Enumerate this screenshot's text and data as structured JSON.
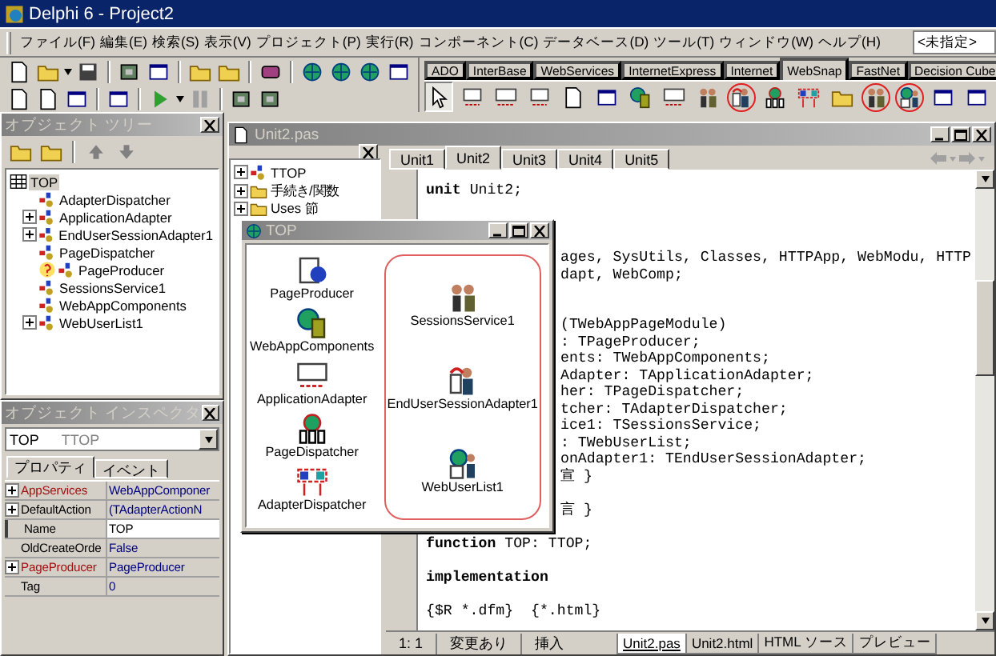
{
  "window": {
    "title": "Delphi 6 - Project2"
  },
  "menu": [
    {
      "label": "ファイル(F)"
    },
    {
      "label": "編集(E)"
    },
    {
      "label": "検索(S)"
    },
    {
      "label": "表示(V)"
    },
    {
      "label": "プロジェクト(P)"
    },
    {
      "label": "実行(R)"
    },
    {
      "label": "コンポーネント(C)"
    },
    {
      "label": "データベース(D)"
    },
    {
      "label": "ツール(T)"
    },
    {
      "label": "ウィンドウ(W)"
    },
    {
      "label": "ヘルプ(H)"
    }
  ],
  "component_combo": {
    "value": "<未指定>"
  },
  "palette": {
    "tabs": [
      {
        "label": "ADO",
        "selected": false
      },
      {
        "label": "InterBase",
        "selected": false
      },
      {
        "label": "WebServices",
        "selected": false
      },
      {
        "label": "InternetExpress",
        "selected": false
      },
      {
        "label": "Internet",
        "selected": false
      },
      {
        "label": "WebSnap",
        "selected": true
      },
      {
        "label": "FastNet",
        "selected": false
      },
      {
        "label": "Decision Cube",
        "selected": false
      }
    ],
    "components": [
      {
        "highlighted": false
      },
      {
        "highlighted": false
      },
      {
        "highlighted": false
      },
      {
        "highlighted": false
      },
      {
        "highlighted": false
      },
      {
        "highlighted": false
      },
      {
        "highlighted": false
      },
      {
        "highlighted": false
      },
      {
        "highlighted": true
      },
      {
        "highlighted": false
      },
      {
        "highlighted": false
      },
      {
        "highlighted": false
      },
      {
        "highlighted": true
      },
      {
        "highlighted": true
      },
      {
        "highlighted": false
      },
      {
        "highlighted": false
      }
    ]
  },
  "object_tree": {
    "title": "オブジェクト ツリー",
    "root": {
      "label": "TOP",
      "selected": true,
      "children": [
        {
          "label": "AdapterDispatcher",
          "expandable": false,
          "warning": false,
          "selected": false
        },
        {
          "label": "ApplicationAdapter",
          "expandable": true,
          "warning": false,
          "selected": false
        },
        {
          "label": "EndUserSessionAdapter1",
          "expandable": true,
          "warning": false,
          "selected": false
        },
        {
          "label": "PageDispatcher",
          "expandable": false,
          "warning": false,
          "selected": false
        },
        {
          "label": "PageProducer",
          "expandable": false,
          "warning": true,
          "selected": false
        },
        {
          "label": "SessionsService1",
          "expandable": false,
          "warning": false,
          "selected": false
        },
        {
          "label": "WebAppComponents",
          "expandable": false,
          "warning": false,
          "selected": false
        },
        {
          "label": "WebUserList1",
          "expandable": true,
          "warning": false,
          "selected": false
        }
      ]
    }
  },
  "object_inspector": {
    "title": "オブジェクト インスペクタ",
    "object": {
      "name": "TOP",
      "type": "TTOP"
    },
    "tabs": [
      {
        "label": "プロパティ",
        "selected": true
      },
      {
        "label": "イベント",
        "selected": false
      }
    ],
    "properties": [
      {
        "name": "AppServices",
        "value": "WebAppComponer",
        "expandable": true,
        "reference": true,
        "selected": false
      },
      {
        "name": "DefaultAction",
        "value": "(TAdapterActionN",
        "expandable": true,
        "reference": false,
        "selected": false
      },
      {
        "name": "Name",
        "value": "TOP",
        "expandable": false,
        "reference": false,
        "selected": true
      },
      {
        "name": "OldCreateOrde",
        "value": "False",
        "expandable": false,
        "reference": false,
        "selected": false
      },
      {
        "name": "PageProducer",
        "value": "PageProducer",
        "expandable": true,
        "reference": true,
        "selected": false
      },
      {
        "name": "Tag",
        "value": "0",
        "expandable": false,
        "reference": false,
        "selected": false
      }
    ]
  },
  "editor": {
    "title": "Unit2.pas",
    "explorer": [
      {
        "label": "TTOP",
        "kind": "class"
      },
      {
        "label": "手続き/関数",
        "kind": "folder"
      },
      {
        "label": "Uses 節",
        "kind": "folder"
      }
    ],
    "tabs": [
      {
        "label": "Unit1",
        "selected": false
      },
      {
        "label": "Unit2",
        "selected": true
      },
      {
        "label": "Unit3",
        "selected": false
      },
      {
        "label": "Unit4",
        "selected": false
      },
      {
        "label": "Unit5",
        "selected": false
      }
    ],
    "code": [
      {
        "kind": "full",
        "keyword": "unit",
        "text": "Unit2;"
      },
      {
        "kind": "blank"
      },
      {
        "kind": "blank"
      },
      {
        "kind": "blank"
      },
      {
        "kind": "clipped",
        "text": "ages, SysUtils, Classes, HTTPApp, WebModu, HTTP"
      },
      {
        "kind": "clipped",
        "text": "dapt, WebComp;"
      },
      {
        "kind": "blank"
      },
      {
        "kind": "blank"
      },
      {
        "kind": "clipped",
        "text": "(TWebAppPageModule)"
      },
      {
        "kind": "clipped",
        "text": ": TPageProducer;"
      },
      {
        "kind": "clipped",
        "text": "ents: TWebAppComponents;"
      },
      {
        "kind": "clipped",
        "text": "Adapter: TApplicationAdapter;"
      },
      {
        "kind": "clipped",
        "text": "her: TPageDispatcher;"
      },
      {
        "kind": "clipped",
        "text": "tcher: TAdapterDispatcher;"
      },
      {
        "kind": "clipped",
        "text": "ice1: TSessionsService;"
      },
      {
        "kind": "clipped",
        "text": ": TWebUserList;"
      },
      {
        "kind": "clipped",
        "text": "onAdapter1: TEndUserSessionAdapter;"
      },
      {
        "kind": "clipped",
        "text": "宣 }"
      },
      {
        "kind": "blank"
      },
      {
        "kind": "clipped",
        "text": "言 }"
      },
      {
        "kind": "blank"
      },
      {
        "kind": "full",
        "keyword": "function",
        "text": "TOP: TTOP;"
      },
      {
        "kind": "blank"
      },
      {
        "kind": "full",
        "keyword": "implementation"
      },
      {
        "kind": "blank"
      },
      {
        "kind": "full",
        "text": "{$R *.dfm}  {*.html}"
      }
    ],
    "status": {
      "position": "1:  1",
      "modified": "変更あり",
      "mode": "挿入"
    },
    "bottom_tabs": [
      {
        "label": "Unit2.pas",
        "selected": true
      },
      {
        "label": "Unit2.html",
        "selected": false
      },
      {
        "label": "HTML ソース",
        "selected": false
      },
      {
        "label": "プレビュー",
        "selected": false
      }
    ]
  },
  "module_window": {
    "title": "TOP",
    "components": [
      {
        "label": "PageProducer",
        "kind": "producer"
      },
      {
        "label": "WebAppComponents",
        "kind": "globe-book"
      },
      {
        "label": "ApplicationAdapter",
        "kind": "adapter"
      },
      {
        "label": "PageDispatcher",
        "kind": "dispatcher"
      },
      {
        "label": "AdapterDispatcher",
        "kind": "adapter-dispatcher"
      }
    ],
    "highlighted_components": [
      {
        "label": "SessionsService1",
        "kind": "people"
      },
      {
        "label": "EndUserSessionAdapter1",
        "kind": "person"
      },
      {
        "label": "WebUserList1",
        "kind": "person-globe"
      }
    ]
  }
}
